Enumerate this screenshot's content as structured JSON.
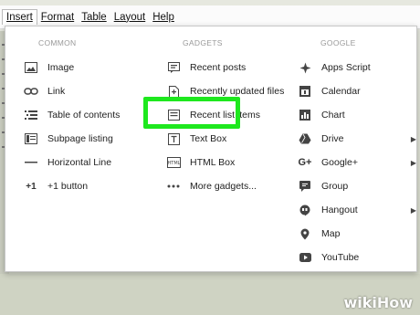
{
  "menubar": {
    "items": [
      {
        "label": "Insert",
        "active": true
      },
      {
        "label": "Format"
      },
      {
        "label": "Table"
      },
      {
        "label": "Layout"
      },
      {
        "label": "Help"
      }
    ]
  },
  "insert_menu": {
    "common": {
      "header": "COMMON",
      "items": [
        {
          "label": "Image",
          "icon": "image-icon"
        },
        {
          "label": "Link",
          "icon": "link-icon"
        },
        {
          "label": "Table of contents",
          "icon": "toc-icon"
        },
        {
          "label": "Subpage listing",
          "icon": "subpage-icon"
        },
        {
          "label": "Horizontal Line",
          "icon": "horizontal-line-icon"
        },
        {
          "label": "+1 button",
          "icon": "plus-one-icon",
          "icon_text": "+1"
        }
      ]
    },
    "gadgets": {
      "header": "GADGETS",
      "items": [
        {
          "label": "Recent posts",
          "icon": "recent-posts-icon"
        },
        {
          "label": "Recently updated files",
          "icon": "updated-files-icon"
        },
        {
          "label": "Recent list items",
          "icon": "list-items-icon"
        },
        {
          "label": "Text Box",
          "icon": "text-box-icon",
          "highlighted": true
        },
        {
          "label": "HTML Box",
          "icon": "html-box-icon"
        },
        {
          "label": "More gadgets...",
          "icon": "more-icon"
        }
      ]
    },
    "google": {
      "header": "GOOGLE",
      "items": [
        {
          "label": "Apps Script",
          "icon": "apps-script-icon"
        },
        {
          "label": "Calendar",
          "icon": "calendar-icon"
        },
        {
          "label": "Chart",
          "icon": "chart-icon"
        },
        {
          "label": "Drive",
          "icon": "drive-icon",
          "submenu": true
        },
        {
          "label": "Google+",
          "icon": "google-plus-icon",
          "submenu": true
        },
        {
          "label": "Group",
          "icon": "group-icon"
        },
        {
          "label": "Hangout",
          "icon": "hangout-icon",
          "submenu": true
        },
        {
          "label": "Map",
          "icon": "map-icon"
        },
        {
          "label": "YouTube",
          "icon": "youtube-icon"
        }
      ]
    }
  },
  "colors": {
    "highlight": "#1ee81e",
    "header_text": "#999999"
  },
  "watermark": {
    "part1": "wiki",
    "part2": "How"
  }
}
